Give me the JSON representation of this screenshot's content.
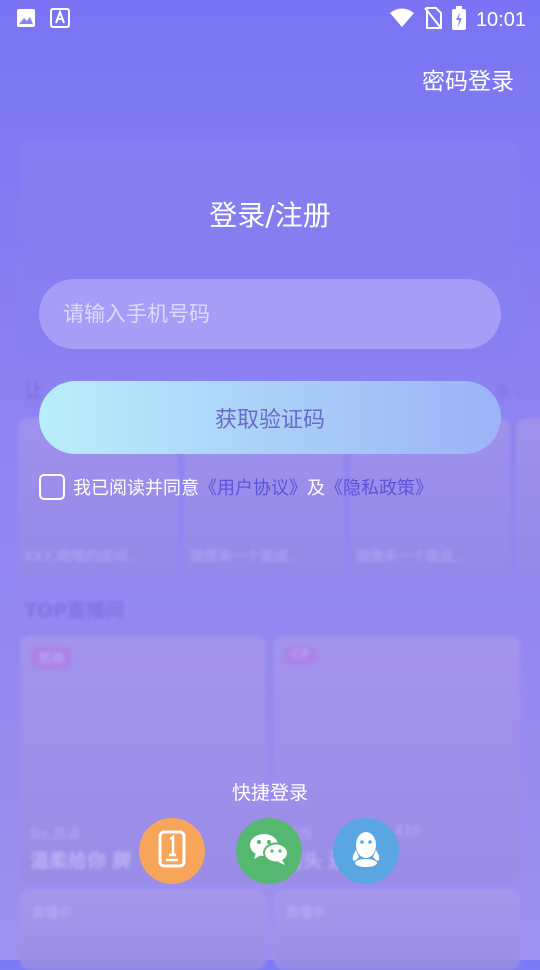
{
  "status_bar": {
    "time": "10:01"
  },
  "header": {
    "password_login": "密码登录"
  },
  "title": "登录/注册",
  "phone_input": {
    "placeholder": "请输入手机号码",
    "value": ""
  },
  "get_code_button": "获取验证码",
  "agreement": {
    "prefix": "我已阅读并同意",
    "user_agreement": "《用户协议》",
    "and": "及",
    "privacy_policy": "《隐私政策》",
    "checked": false
  },
  "quick_login": {
    "title": "快捷登录",
    "methods": [
      "phone-icon",
      "wechat-icon",
      "qq-icon"
    ]
  },
  "background": {
    "section_partial": "让",
    "more": "多 ›",
    "cards": [
      "XXX,嗯嗯的房间...",
      "随便来一个能说...",
      "随便来一个能说..."
    ],
    "top_section": "TOP直播间",
    "live_tiles": [
      {
        "tag": "男神",
        "name": "Ns.苏沫",
        "desc": "温柔给你 脾"
      },
      {
        "tag": "CP",
        "name": "范西",
        "number": "430",
        "desc": "河头 还有我"
      }
    ],
    "live_label": "直播中"
  },
  "colors": {
    "background_top": "#7b79f6",
    "accent_link": "#5a54d8",
    "phone_button": "#f6a55a",
    "wechat_button": "#56b870",
    "qq_button": "#5aa6e3"
  }
}
